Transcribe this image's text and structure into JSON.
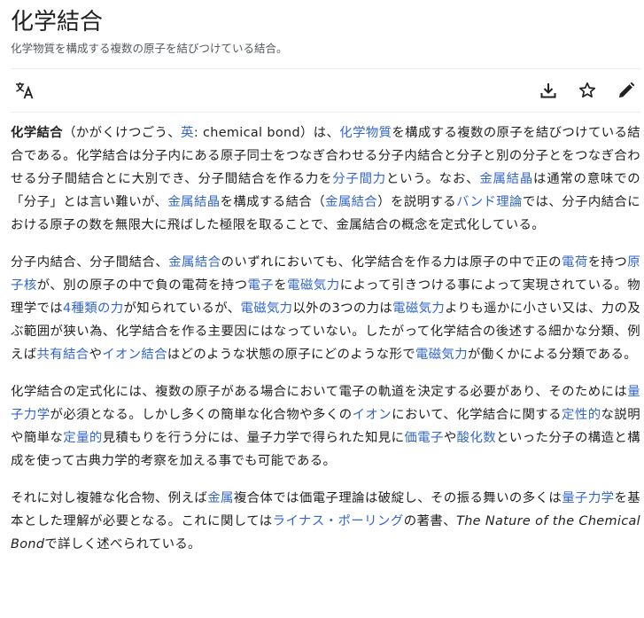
{
  "header": {
    "title": "化学結合",
    "subtitle": "化学物質を構成する複数の原子を結びつけている結合。"
  },
  "toolbar": {
    "language_icon": "translate-icon",
    "download_icon": "download-icon",
    "watch_icon": "star-icon",
    "edit_icon": "pencil-icon"
  },
  "colors": {
    "link": "#3366cc",
    "text": "#202122",
    "muted": "#54595d"
  },
  "article": {
    "p1": {
      "s1": "化学結合",
      "s2": "（かがくけつごう、",
      "s3": "英",
      "s4": ": chemical bond）は、",
      "s5": "化学物質",
      "s6": "を構成する複数の原子を結びつけている結合である。化学結合は分子内にある原子同士をつなぎ合わせる分子内結合と分子と別の分子とをつなぎ合わせる分子間結合とに大別でき、分子間結合を作る力を",
      "s7": "分子間力",
      "s8": "という。なお、",
      "s9": "金属結晶",
      "s10": "は通常の意味での「分子」とは言い難いが、",
      "s11": "金属結晶",
      "s12": "を構成する結合（",
      "s13": "金属結合",
      "s14": "）を説明する",
      "s15": "バンド理論",
      "s16": "では、分子内結合における原子の数を無限大に飛ばした極限を取ることで、金属結合の概念を定式化している。"
    },
    "p2": {
      "s1": "分子内結合、分子間結合、",
      "s2": "金属結合",
      "s3": "のいずれにおいても、化学結合を作る力は原子の中で正の",
      "s4": "電荷",
      "s5": "を持つ",
      "s6": "原子核",
      "s7": "が、別の原子の中で負の電荷を持つ",
      "s8": "電子",
      "s9": "を",
      "s10": "電磁気力",
      "s11": "によって引きつける事によって実現されている。物理学では",
      "s12": "4種類の力",
      "s13": "が知られているが、",
      "s14": "電磁気力",
      "s15": "以外の3つの力は",
      "s16": "電磁気力",
      "s17": "よりも遥かに小さい又は、力の及ぶ範囲が狭い為、化学結合を作る主要因にはなっていない。したがって化学結合の後述する細かな分類、例えば",
      "s18": "共有結合",
      "s19": "や",
      "s20": "イオン結合",
      "s21": "はどのような状態の原子にどのような形で",
      "s22": "電磁気力",
      "s23": "が働くかによる分類である。"
    },
    "p3": {
      "s1": "化学結合の定式化には、複数の原子がある場合において電子の軌道を決定する必要があり、そのためには",
      "s2": "量子力学",
      "s3": "が必須となる。しかし多くの簡単な化合物や多くの",
      "s4": "イオン",
      "s5": "において、化学結合に関する",
      "s6": "定性的",
      "s7": "な説明や簡単な",
      "s8": "定量的",
      "s9": "見積もりを行う分には、量子力学で得られた知見に",
      "s10": "価電子",
      "s11": "や",
      "s12": "酸化数",
      "s13": "といった分子の構造と構成を使って古典力学的考察を加える事でも可能である。"
    },
    "p4": {
      "s1": "それに対し複雑な化合物、例えば",
      "s2": "金属",
      "s3": "複合体では価電子理論は破綻し、その振る舞いの多くは",
      "s4": "量子力学",
      "s5": "を基本とした理解が必要となる。これに関しては",
      "s6": "ライナス・ポーリング",
      "s7": "の著書、",
      "s8": "The Nature of the Chemical Bond",
      "s9": "で詳しく述べられている。"
    }
  }
}
